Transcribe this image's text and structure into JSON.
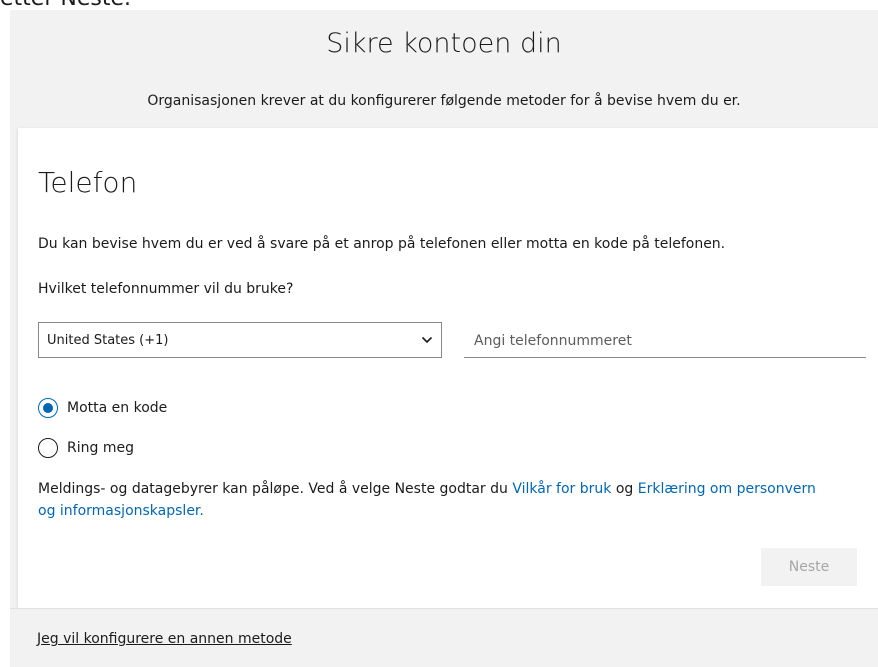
{
  "top_fragment": "etter Neste.",
  "header": {
    "title": "Sikre kontoen din",
    "subtitle": "Organisasjonen krever at du konfigurerer følgende metoder for å bevise hvem du er."
  },
  "card": {
    "title": "Telefon",
    "description": "Du kan bevise hvem du er ved å svare på et anrop på telefonen eller motta en kode på telefonen.",
    "question": "Hvilket telefonnummer vil du bruke?",
    "country_select": {
      "value": "United States (+1)"
    },
    "phone_input": {
      "placeholder": "Angi telefonnummeret",
      "value": ""
    },
    "radio_options": [
      {
        "label": "Motta en kode",
        "checked": true
      },
      {
        "label": "Ring meg",
        "checked": false
      }
    ],
    "disclaimer": {
      "text_before": "Meldings- og datagebyrer kan påløpe. Ved å velge Neste godtar du ",
      "terms_link": "Vilkår for bruk",
      "middle": " og ",
      "privacy_link": "Erklæring om personvern og informasjonskapsler.",
      "link_color": "#0067b8"
    },
    "next_button": {
      "label": "Neste",
      "disabled": true
    }
  },
  "footer": {
    "link": "Jeg vil konfigurere en annen metode"
  },
  "colors": {
    "accent": "#0067b8",
    "page_background": "#f2f2f2",
    "card_background": "#ffffff",
    "text": "#1b1b1b"
  },
  "icons": {
    "select_chevron": "chevron-down-icon"
  }
}
